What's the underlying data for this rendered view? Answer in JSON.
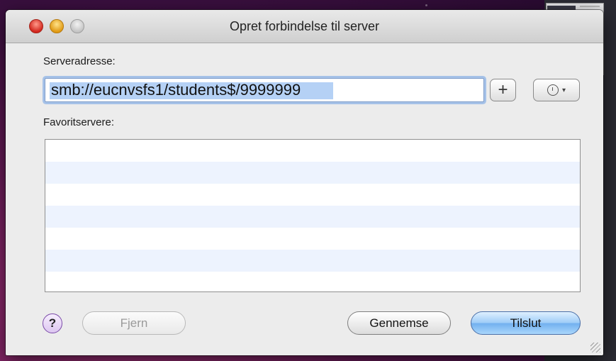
{
  "window": {
    "title": "Opret forbindelse til server"
  },
  "server_address": {
    "label": "Serveradresse:",
    "value": "smb://eucnvsfs1/students$/9999999"
  },
  "favorites": {
    "label": "Favoritservere:",
    "rows": []
  },
  "icons": {
    "add": "plus-icon",
    "recent": "clock-icon",
    "dropdown": "chevron-down-icon",
    "help": "question-mark-icon"
  },
  "buttons": {
    "help_label": "?",
    "add_label": "+",
    "dropdown_glyph": "▾",
    "remove_label": "Fjern",
    "browse_label": "Gennemse",
    "connect_label": "Tilslut"
  },
  "colors": {
    "selection": "#b5d1f5",
    "row_alt": "#edf3fe",
    "default_button": "#8ec3f5"
  }
}
